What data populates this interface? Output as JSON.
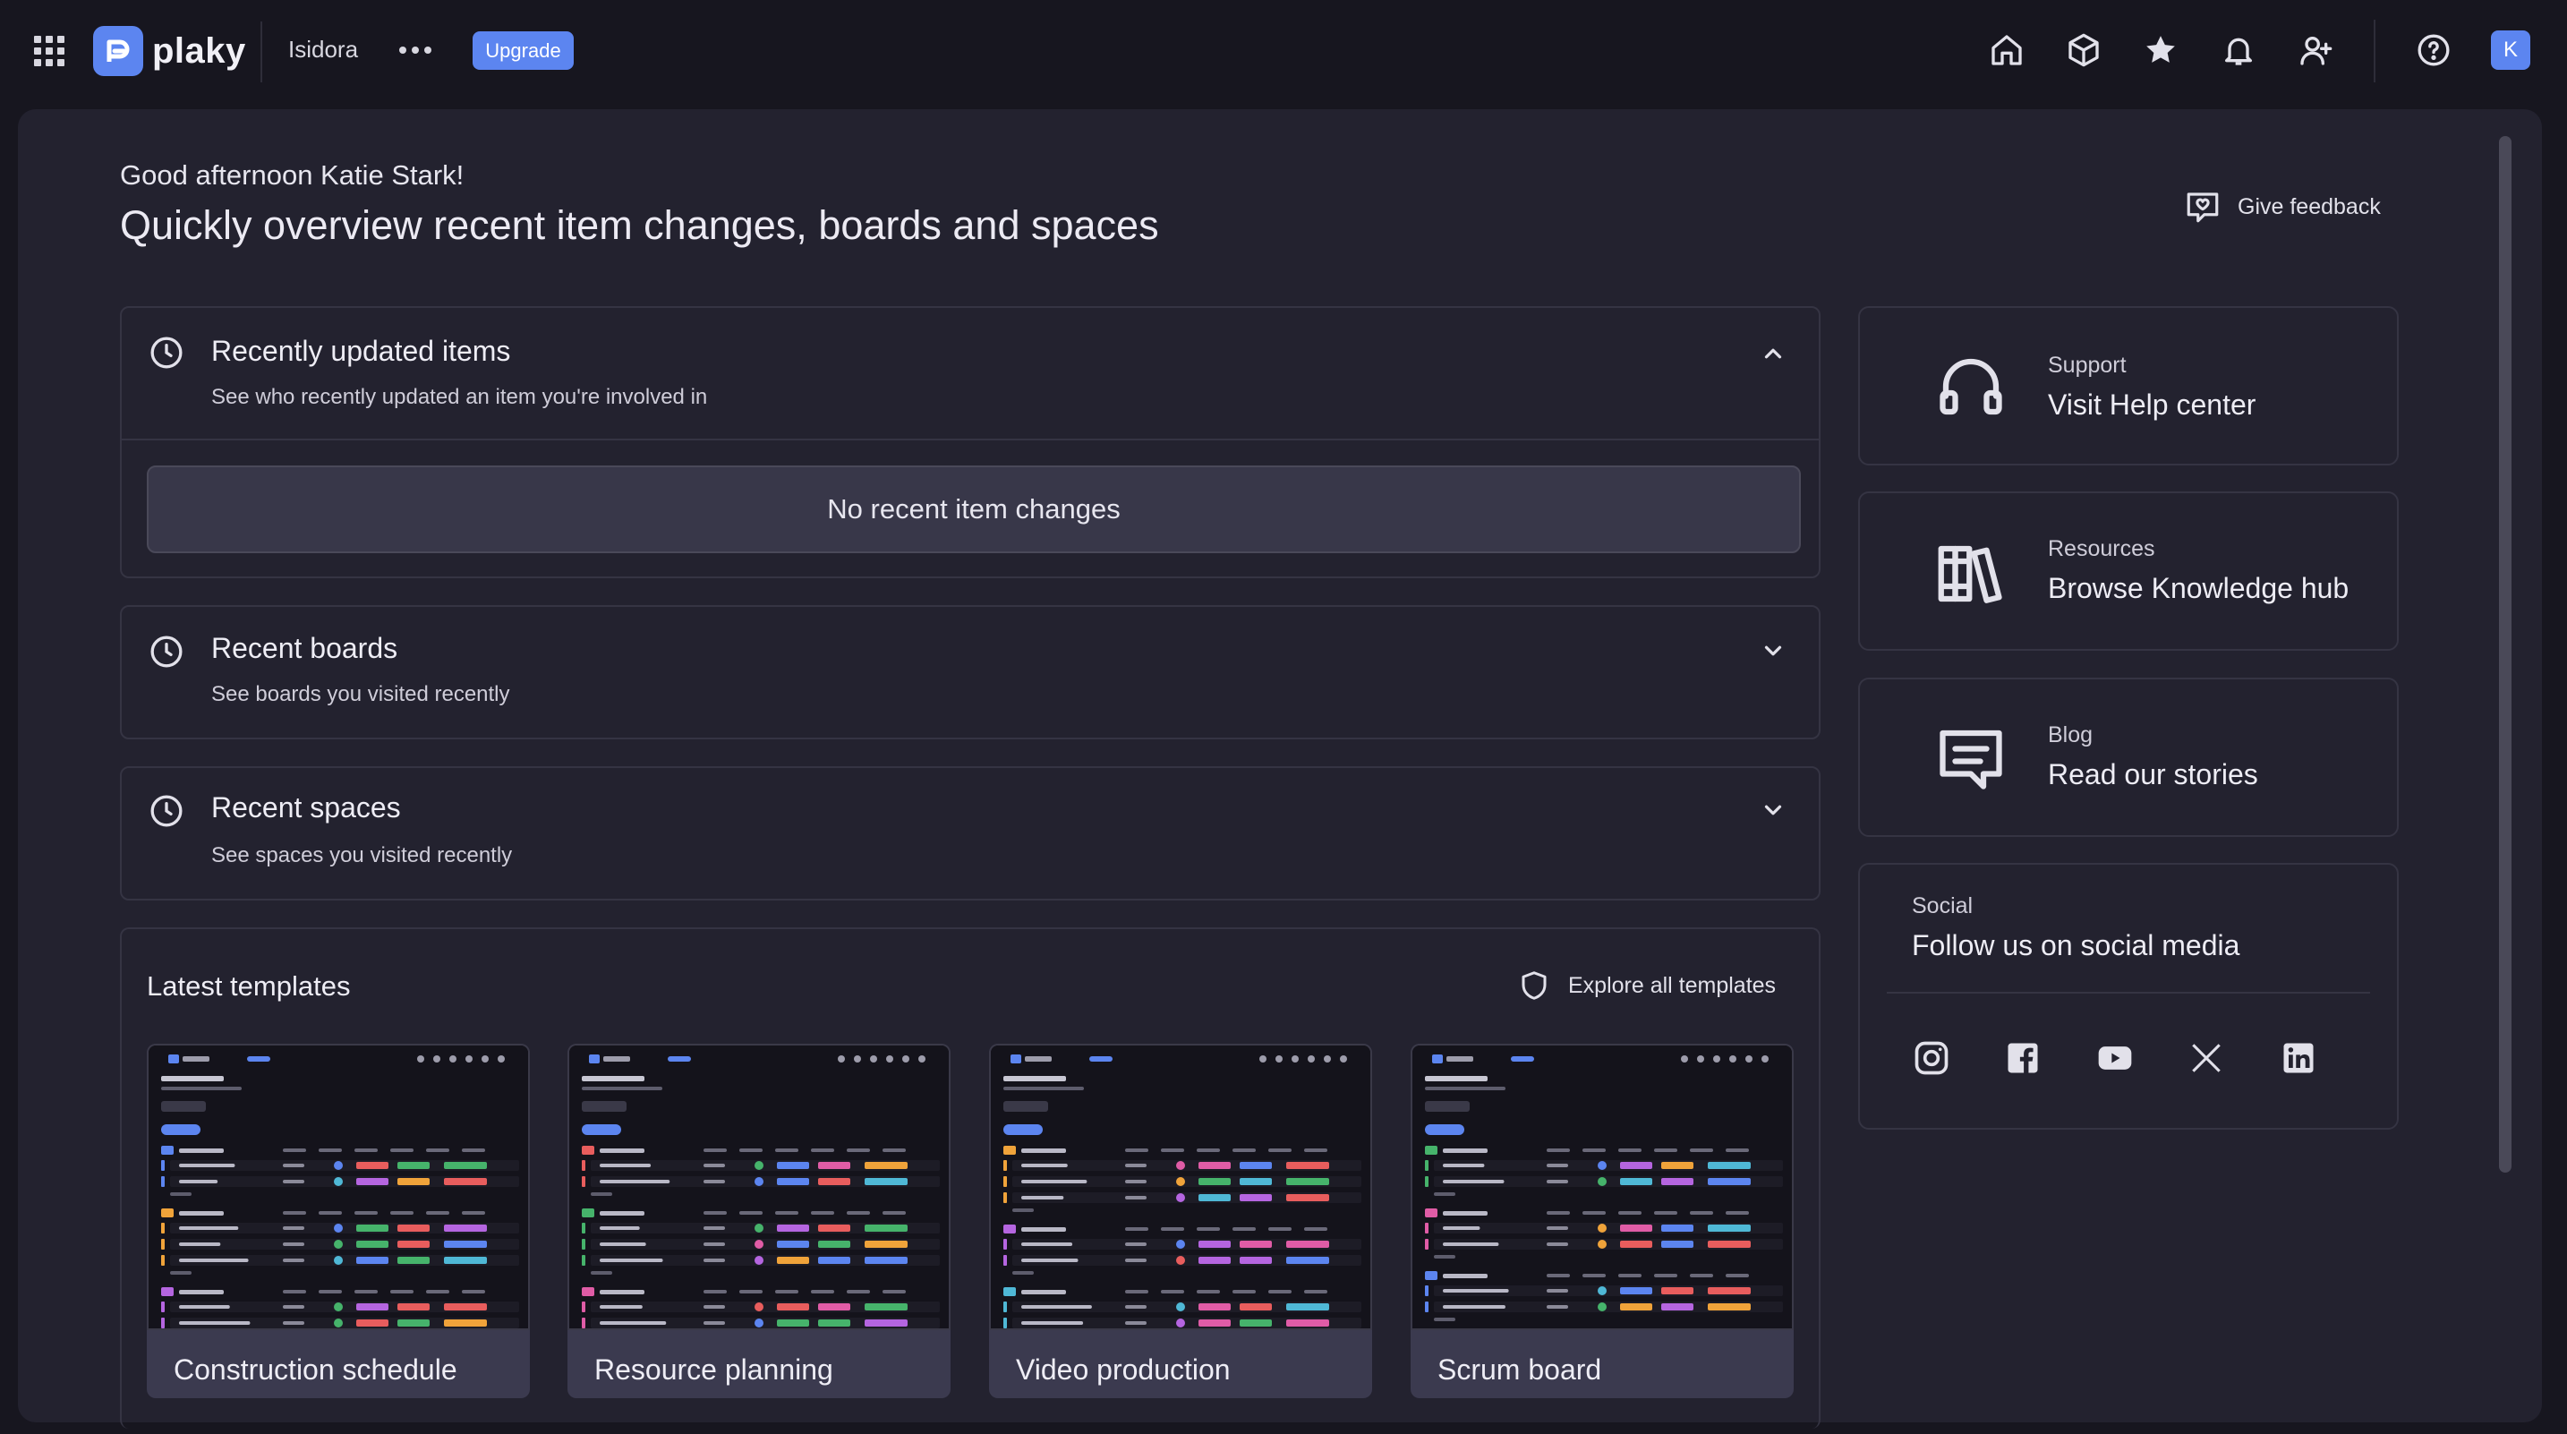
{
  "topbar": {
    "logo_text": "plaky",
    "workspace_name": "Isidora",
    "upgrade_label": "Upgrade",
    "avatar_initial": "K",
    "icons": [
      "home-icon",
      "cube-icon",
      "star-icon",
      "bell-icon",
      "add-user-icon",
      "help-icon"
    ]
  },
  "header": {
    "greeting": "Good afternoon Katie Stark!",
    "headline": "Quickly overview recent item changes, boards and spaces",
    "feedback_label": "Give feedback"
  },
  "recently_updated": {
    "title": "Recently updated items",
    "subtitle": "See who recently updated an item you're involved in",
    "empty_text": "No recent item changes"
  },
  "recent_boards": {
    "title": "Recent boards",
    "subtitle": "See boards you visited recently"
  },
  "recent_spaces": {
    "title": "Recent spaces",
    "subtitle": "See spaces you visited recently"
  },
  "templates": {
    "title": "Latest templates",
    "explore_label": "Explore all templates",
    "items": [
      {
        "name": "Construction schedule"
      },
      {
        "name": "Resource planning"
      },
      {
        "name": "Video production"
      },
      {
        "name": "Scrum board"
      }
    ]
  },
  "sidebar": {
    "support": {
      "label": "Support",
      "title": "Visit Help center"
    },
    "resources": {
      "label": "Resources",
      "title": "Browse Knowledge hub"
    },
    "blog": {
      "label": "Blog",
      "title": "Read our stories"
    },
    "social": {
      "label": "Social",
      "title": "Follow us on social media",
      "networks": [
        "instagram-icon",
        "facebook-icon",
        "youtube-icon",
        "x-icon",
        "linkedin-icon"
      ]
    }
  },
  "colors": {
    "accent": "#5c85f0",
    "background": "#17161f",
    "panel": "#23222f"
  }
}
